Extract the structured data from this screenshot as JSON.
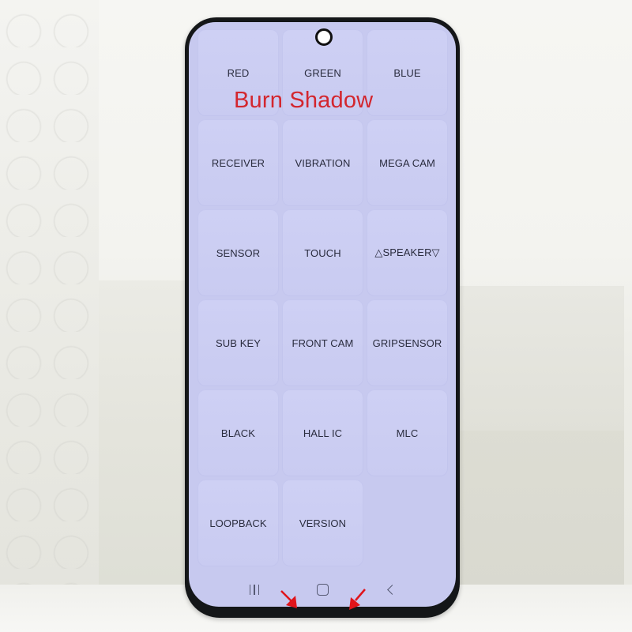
{
  "overlay": {
    "label": "Burn Shadow",
    "color": "#d3262e"
  },
  "screen": {
    "background": "#c7c9ef",
    "tiles": [
      {
        "label": "RED"
      },
      {
        "label": "GREEN"
      },
      {
        "label": "BLUE"
      },
      {
        "label": "RECEIVER"
      },
      {
        "label": "VIBRATION"
      },
      {
        "label": "MEGA CAM"
      },
      {
        "label": "SENSOR"
      },
      {
        "label": "TOUCH"
      },
      {
        "label": "△SPEAKER▽"
      },
      {
        "label": "SUB KEY"
      },
      {
        "label": "FRONT CAM"
      },
      {
        "label": "GRIPSENSOR"
      },
      {
        "label": "BLACK"
      },
      {
        "label": "HALL IC"
      },
      {
        "label": "MLC"
      },
      {
        "label": "LOOPBACK"
      },
      {
        "label": "VERSION"
      }
    ]
  },
  "navbar": {
    "buttons": [
      {
        "name": "recents",
        "icon": "recents-icon"
      },
      {
        "name": "home",
        "icon": "home-icon"
      },
      {
        "name": "back",
        "icon": "back-icon"
      }
    ]
  },
  "annotations": {
    "arrows": [
      {
        "icon": "red-arrow-icon",
        "direction": "down-right"
      },
      {
        "icon": "red-arrow-icon",
        "direction": "down-left"
      }
    ]
  }
}
